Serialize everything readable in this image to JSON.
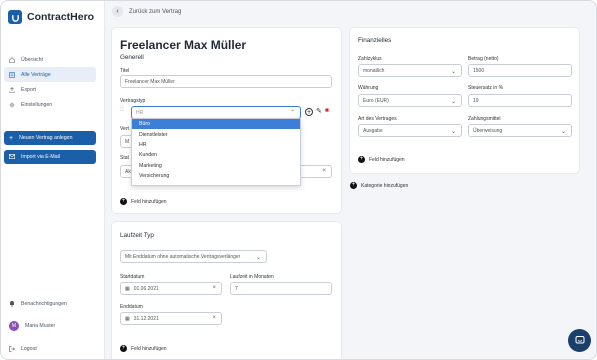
{
  "app": {
    "name": "ContractHero"
  },
  "sidebar": {
    "items": [
      {
        "label": "Übersicht",
        "icon": "home-icon",
        "active": false
      },
      {
        "label": "Alle Verträge",
        "icon": "list-icon",
        "active": true
      },
      {
        "label": "Export",
        "icon": "export-icon",
        "active": false
      },
      {
        "label": "Einstellungen",
        "icon": "gear-icon",
        "active": false
      }
    ],
    "new_contract": "Neuen Vertrag anlegen",
    "import_email": "Import via E-Mail",
    "notifications": "Benachrichtigungen",
    "user_initial": "M",
    "user_name": "Maria Muster",
    "logout": "Logout"
  },
  "topbar": {
    "back_label": "Zurück zum Vertrag"
  },
  "main": {
    "title": "Freelancer Max Müller",
    "general": {
      "heading": "Generell",
      "title_label": "Titel",
      "title_value": "Freelancer Max Müller",
      "type_label": "Vertragstyp",
      "type_value": "HR",
      "partial_label_1": "Vert",
      "partial_value_1": "M",
      "partial_label_2": "Stat",
      "partial_value_2": "Ak",
      "add_field": "Feld hinzufügen"
    },
    "dropdown": {
      "options": [
        "Büro",
        "Dienstleister",
        "HR",
        "Kunden",
        "Marketing",
        "Versicherung"
      ],
      "selected_index": 0
    },
    "runtime": {
      "heading": "Laufzeit Typ",
      "type_value": "Mit Enddatum ohne automatische Vertragsverlänger",
      "start_label": "Startdatum",
      "start_value": "01.06.2021",
      "months_label": "Laufzeit in Monaten",
      "months_value": "7",
      "end_label": "Enddatum",
      "end_value": "31.12.2021",
      "add_field": "Feld hinzufügen"
    }
  },
  "finance": {
    "heading": "Finanzielles",
    "cycle_label": "Zahlzyklus",
    "cycle_value": "monatlich",
    "amount_label": "Betrag (netto)",
    "amount_value": "1500",
    "currency_label": "Währung",
    "currency_value": "Euro (EUR)",
    "tax_label": "Steuersatz in %",
    "tax_value": "19",
    "kind_label": "Art des Vertrages",
    "kind_value": "Ausgabe",
    "payment_label": "Zahlungsmittel",
    "payment_value": "Überweisung",
    "add_field": "Feld hinzufügen",
    "add_category": "Kategorie hinzufügen"
  },
  "colors": {
    "primary": "#1b5fa8",
    "selected": "#3d7fd8",
    "chat": "#1b3f6b"
  }
}
